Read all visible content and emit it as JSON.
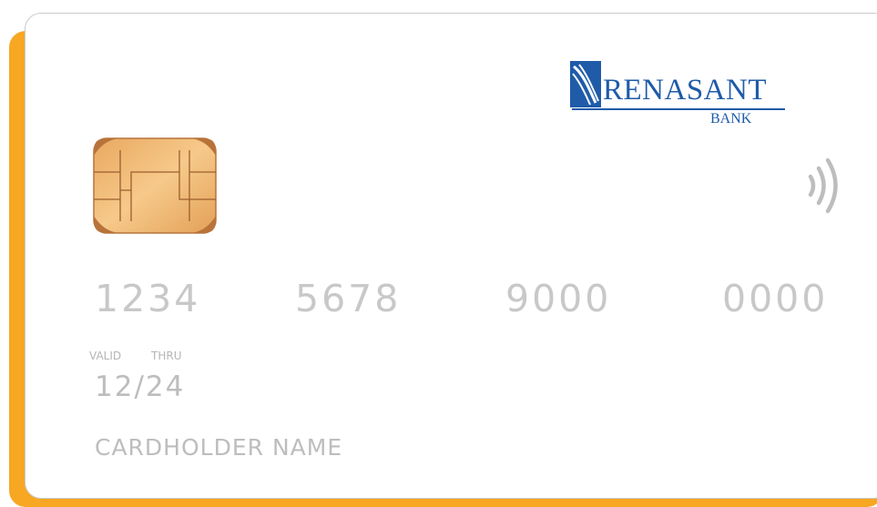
{
  "card": {
    "brand": {
      "name": "RENASANT",
      "sub": "BANK",
      "color": "#1f5ba8"
    },
    "accent_color": "#f7a722",
    "chip_icon": "emv-chip-icon",
    "contactless_icon": "contactless-icon",
    "number_groups": [
      "1234",
      "5678",
      "9000",
      "0000"
    ],
    "valid_label": "VALID",
    "thru_label": "THRU",
    "expiry": "12/24",
    "cardholder": "CARDHOLDER NAME"
  }
}
